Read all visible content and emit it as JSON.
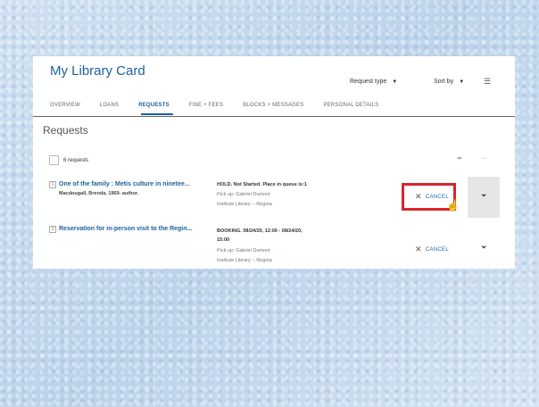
{
  "card": {
    "title": "My Library Card"
  },
  "tabs": [
    {
      "label": "OVERVIEW"
    },
    {
      "label": "LOANS"
    },
    {
      "label": "REQUESTS"
    },
    {
      "label": "FINE + FEES"
    },
    {
      "label": "BLOCKS + MESSAGES"
    },
    {
      "label": "PERSONAL DETAILS"
    }
  ],
  "active_tab": "REQUESTS",
  "section": {
    "title": "Requests",
    "request_type_label": "Request type",
    "sort_by_label": "Sort by",
    "count_label": "6 requests"
  },
  "requests": [
    {
      "num": "1",
      "title": "One of the family : Metis culture in ninetee...",
      "author": "Macdougall, Brenda, 1969- author.",
      "status": "HOLD. Not Started. Place in queue is:1",
      "pickup": "Pick up: Gabriel Dumont",
      "library": "Institute Library -- Regina",
      "cancel_label": "CANCEL"
    },
    {
      "num": "2",
      "title": "Reservation for in-person visit to the Regin...",
      "status": "BOOKING. 08/24/20, 12:00 - 08/24/20,",
      "time": "15:00",
      "pickup": "Pick up: Gabriel Dumont",
      "library": "Institute Library -- Regina",
      "cancel_label": "CANCEL"
    }
  ],
  "icons": {
    "caret": "▼",
    "filter": "☰",
    "pin": "✒",
    "more": "···",
    "close": "✕",
    "chevron": "⌄",
    "pointer": "☝"
  }
}
